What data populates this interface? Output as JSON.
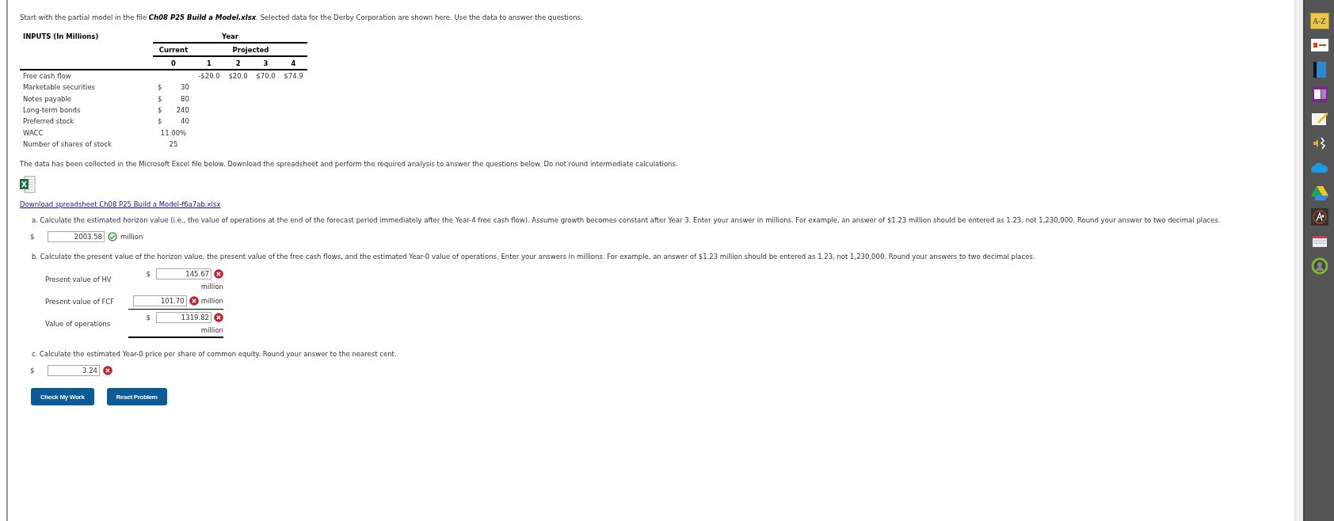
{
  "intro": "Start with the partial model in the file **Ch08 P25 Build a Model.xlsx**. Selected data for the Derby Corporation are shown here. Use the data to answer the questions.",
  "inputs_table": {
    "title": "INPUTS (In Millions)",
    "year_header": "Year",
    "current_header": "Current",
    "projected_header": "Projected",
    "periods": [
      "0",
      "1",
      "2",
      "3",
      "4"
    ],
    "rows": [
      {
        "label": "Free cash flow",
        "projected": [
          "-$20.0",
          "$20.0",
          "$70.0",
          "$74.9"
        ]
      },
      {
        "label": "Marketable securities",
        "current": {
          "currency": "$",
          "amount": "30"
        }
      },
      {
        "label": "Notes payable",
        "current": {
          "currency": "$",
          "amount": "80"
        }
      },
      {
        "label": "Long-term bonds",
        "current": {
          "currency": "$",
          "amount": "240"
        }
      },
      {
        "label": "Preferred stock",
        "current": {
          "currency": "$",
          "amount": "40"
        }
      },
      {
        "label": "WACC",
        "current": {
          "amount": "11.00%"
        }
      },
      {
        "label": "Number of shares of stock",
        "current": {
          "amount": "25"
        }
      }
    ]
  },
  "data_note": "The data has been collected in the Microsoft Excel file below. Download the spreadsheet and perform the required analysis to answer the questions below. Do not round intermediate calculations.",
  "download_link": "Download spreadsheet Ch08 P25 Build a Model-f6a7ab.xlsx",
  "part_a": {
    "question": "a. Calculate the estimated horizon value (i.e., the value of operations at the end of the forecast period immediately after the Year-4 free cash flow). Assume growth becomes constant after Year 3. Enter your answer in millions. For example, an answer of $1.23 million should be entered as 1.23, not 1,230,000. Round your answer to two decimal places.",
    "currency": "$",
    "value": "2003.58",
    "correct": true,
    "unit": "million"
  },
  "part_b": {
    "question": "b. Calculate the present value of the horizon value, the present value of the free cash flows, and the estimated Year-0 value of operations. Enter your answers in millions. For example, an answer of $1.23 million should be entered as 1.23, not 1,230,000. Round your answers to two decimal places.",
    "rows": [
      {
        "label": "Present value of HV",
        "currency": "$",
        "value": "145.67",
        "correct": false,
        "unit": "million"
      },
      {
        "label": "Present value of FCF",
        "value": "101.70",
        "correct": false,
        "unit": "million"
      },
      {
        "label": "Value of operations",
        "currency": "$",
        "value": "1319.82",
        "correct": false,
        "unit": "million"
      }
    ]
  },
  "part_c": {
    "question": "c. Calculate the estimated Year-0 price per share of common equity. Round your answer to the nearest cent.",
    "currency": "$",
    "value": "3.24",
    "correct": false
  },
  "buttons": [
    "Check My Work",
    "Reset Problem"
  ],
  "toolbar_items": [
    {
      "kind": "dictionary",
      "label": "A-Z"
    },
    {
      "kind": "office"
    },
    {
      "kind": "book"
    },
    {
      "kind": "notebook"
    },
    {
      "kind": "notepad"
    },
    {
      "kind": "speech"
    },
    {
      "kind": "cloud"
    },
    {
      "kind": "drive"
    },
    {
      "kind": "grade"
    },
    {
      "kind": "cards"
    },
    {
      "kind": "profile"
    }
  ]
}
